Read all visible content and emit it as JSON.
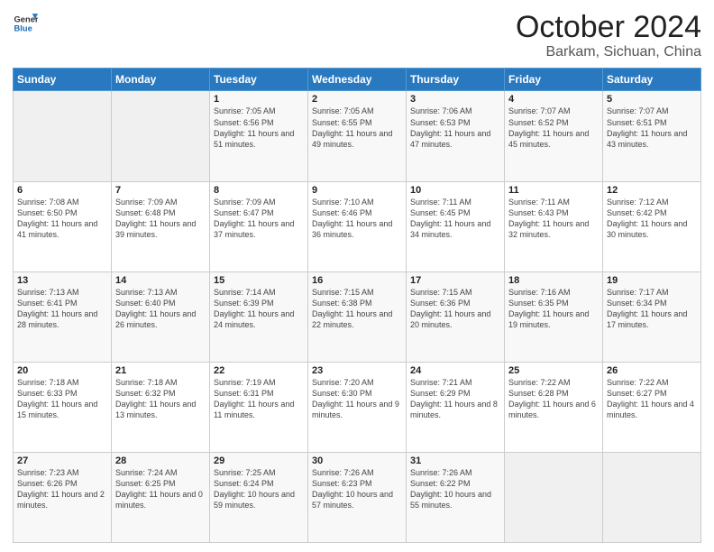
{
  "header": {
    "logo_line1": "General",
    "logo_line2": "Blue",
    "month": "October 2024",
    "location": "Barkam, Sichuan, China"
  },
  "weekdays": [
    "Sunday",
    "Monday",
    "Tuesday",
    "Wednesday",
    "Thursday",
    "Friday",
    "Saturday"
  ],
  "weeks": [
    [
      {
        "day": "",
        "info": ""
      },
      {
        "day": "",
        "info": ""
      },
      {
        "day": "1",
        "info": "Sunrise: 7:05 AM\nSunset: 6:56 PM\nDaylight: 11 hours and 51 minutes."
      },
      {
        "day": "2",
        "info": "Sunrise: 7:05 AM\nSunset: 6:55 PM\nDaylight: 11 hours and 49 minutes."
      },
      {
        "day": "3",
        "info": "Sunrise: 7:06 AM\nSunset: 6:53 PM\nDaylight: 11 hours and 47 minutes."
      },
      {
        "day": "4",
        "info": "Sunrise: 7:07 AM\nSunset: 6:52 PM\nDaylight: 11 hours and 45 minutes."
      },
      {
        "day": "5",
        "info": "Sunrise: 7:07 AM\nSunset: 6:51 PM\nDaylight: 11 hours and 43 minutes."
      }
    ],
    [
      {
        "day": "6",
        "info": "Sunrise: 7:08 AM\nSunset: 6:50 PM\nDaylight: 11 hours and 41 minutes."
      },
      {
        "day": "7",
        "info": "Sunrise: 7:09 AM\nSunset: 6:48 PM\nDaylight: 11 hours and 39 minutes."
      },
      {
        "day": "8",
        "info": "Sunrise: 7:09 AM\nSunset: 6:47 PM\nDaylight: 11 hours and 37 minutes."
      },
      {
        "day": "9",
        "info": "Sunrise: 7:10 AM\nSunset: 6:46 PM\nDaylight: 11 hours and 36 minutes."
      },
      {
        "day": "10",
        "info": "Sunrise: 7:11 AM\nSunset: 6:45 PM\nDaylight: 11 hours and 34 minutes."
      },
      {
        "day": "11",
        "info": "Sunrise: 7:11 AM\nSunset: 6:43 PM\nDaylight: 11 hours and 32 minutes."
      },
      {
        "day": "12",
        "info": "Sunrise: 7:12 AM\nSunset: 6:42 PM\nDaylight: 11 hours and 30 minutes."
      }
    ],
    [
      {
        "day": "13",
        "info": "Sunrise: 7:13 AM\nSunset: 6:41 PM\nDaylight: 11 hours and 28 minutes."
      },
      {
        "day": "14",
        "info": "Sunrise: 7:13 AM\nSunset: 6:40 PM\nDaylight: 11 hours and 26 minutes."
      },
      {
        "day": "15",
        "info": "Sunrise: 7:14 AM\nSunset: 6:39 PM\nDaylight: 11 hours and 24 minutes."
      },
      {
        "day": "16",
        "info": "Sunrise: 7:15 AM\nSunset: 6:38 PM\nDaylight: 11 hours and 22 minutes."
      },
      {
        "day": "17",
        "info": "Sunrise: 7:15 AM\nSunset: 6:36 PM\nDaylight: 11 hours and 20 minutes."
      },
      {
        "day": "18",
        "info": "Sunrise: 7:16 AM\nSunset: 6:35 PM\nDaylight: 11 hours and 19 minutes."
      },
      {
        "day": "19",
        "info": "Sunrise: 7:17 AM\nSunset: 6:34 PM\nDaylight: 11 hours and 17 minutes."
      }
    ],
    [
      {
        "day": "20",
        "info": "Sunrise: 7:18 AM\nSunset: 6:33 PM\nDaylight: 11 hours and 15 minutes."
      },
      {
        "day": "21",
        "info": "Sunrise: 7:18 AM\nSunset: 6:32 PM\nDaylight: 11 hours and 13 minutes."
      },
      {
        "day": "22",
        "info": "Sunrise: 7:19 AM\nSunset: 6:31 PM\nDaylight: 11 hours and 11 minutes."
      },
      {
        "day": "23",
        "info": "Sunrise: 7:20 AM\nSunset: 6:30 PM\nDaylight: 11 hours and 9 minutes."
      },
      {
        "day": "24",
        "info": "Sunrise: 7:21 AM\nSunset: 6:29 PM\nDaylight: 11 hours and 8 minutes."
      },
      {
        "day": "25",
        "info": "Sunrise: 7:22 AM\nSunset: 6:28 PM\nDaylight: 11 hours and 6 minutes."
      },
      {
        "day": "26",
        "info": "Sunrise: 7:22 AM\nSunset: 6:27 PM\nDaylight: 11 hours and 4 minutes."
      }
    ],
    [
      {
        "day": "27",
        "info": "Sunrise: 7:23 AM\nSunset: 6:26 PM\nDaylight: 11 hours and 2 minutes."
      },
      {
        "day": "28",
        "info": "Sunrise: 7:24 AM\nSunset: 6:25 PM\nDaylight: 11 hours and 0 minutes."
      },
      {
        "day": "29",
        "info": "Sunrise: 7:25 AM\nSunset: 6:24 PM\nDaylight: 10 hours and 59 minutes."
      },
      {
        "day": "30",
        "info": "Sunrise: 7:26 AM\nSunset: 6:23 PM\nDaylight: 10 hours and 57 minutes."
      },
      {
        "day": "31",
        "info": "Sunrise: 7:26 AM\nSunset: 6:22 PM\nDaylight: 10 hours and 55 minutes."
      },
      {
        "day": "",
        "info": ""
      },
      {
        "day": "",
        "info": ""
      }
    ]
  ]
}
